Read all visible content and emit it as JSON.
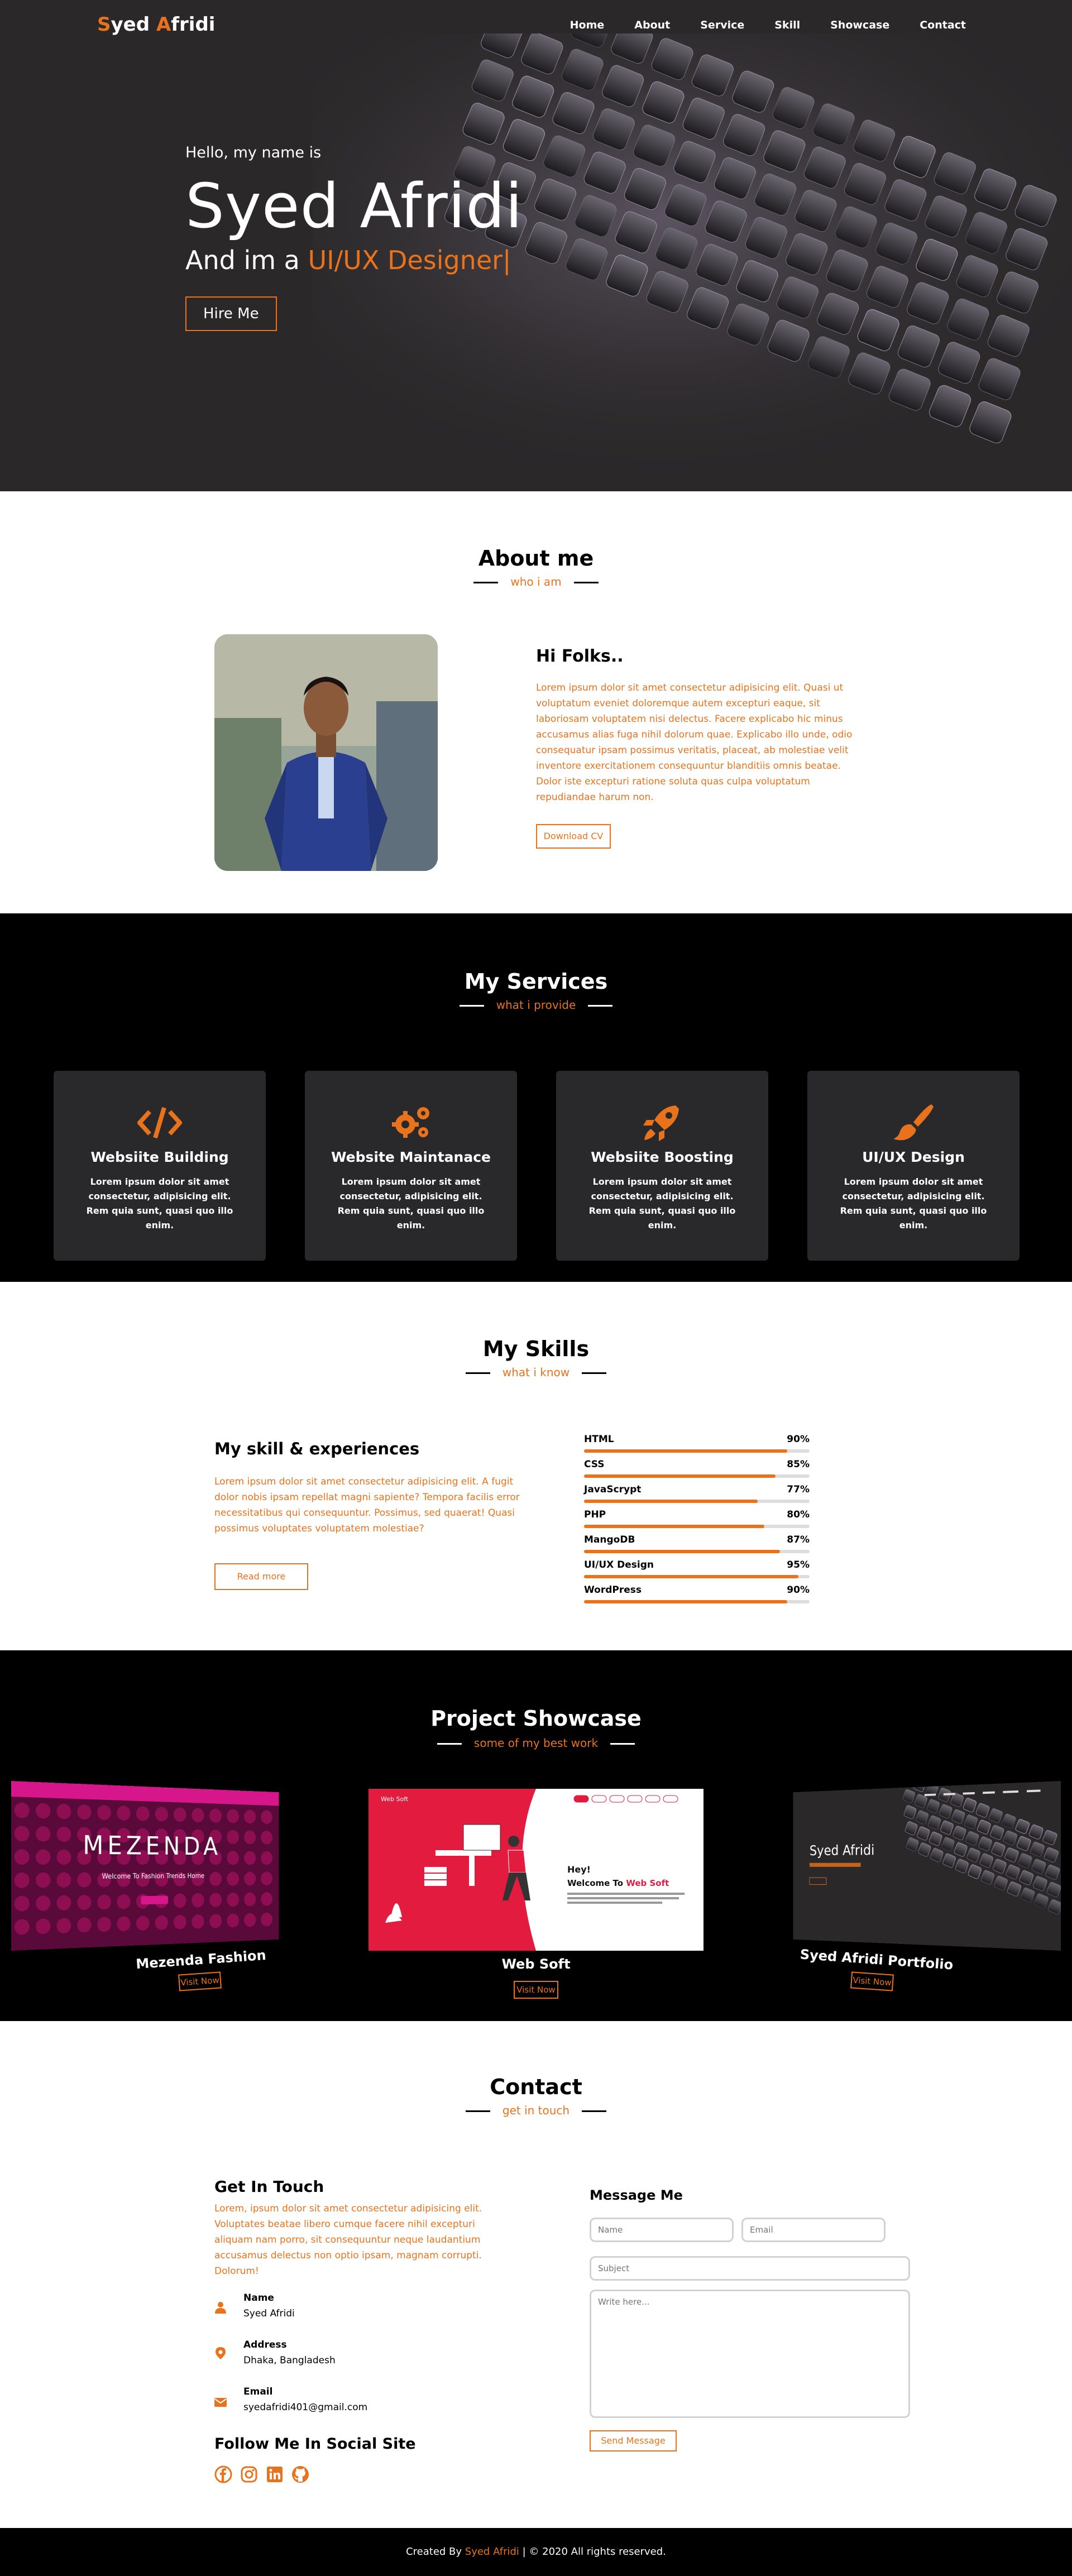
{
  "nav": {
    "logo_first_initial": "S",
    "logo_first_rest": "yed ",
    "logo_last_initial": "A",
    "logo_last_rest": "fridi",
    "items": [
      "Home",
      "About",
      "Service",
      "Skill",
      "Showcase",
      "Contact"
    ]
  },
  "hero": {
    "greeting": "Hello, my name is",
    "name": "Syed Afridi",
    "tagline_prefix": "And im a ",
    "tagline_role": "UI/UX Designer|",
    "hire_button": "Hire Me"
  },
  "about": {
    "title": "About me",
    "subtitle": "who i am",
    "heading": "Hi Folks..",
    "body": "Lorem ipsum dolor sit amet consectetur adipisicing elit. Quasi ut voluptatum eveniet doloremque autem excepturi eaque, sit laboriosam voluptatem nisi delectus. Facere explicabo hic minus accusamus alias fuga nihil dolorum quae. Explicabo illo unde, odio consequatur ipsam possimus veritatis, placeat, ab molestiae velit inventore exercitationem consequuntur blanditiis omnis beatae. Dolor iste excepturi ratione soluta quas culpa voluptatum repudiandae harum non.",
    "cv_button": "Download CV"
  },
  "services": {
    "title": "My Services",
    "subtitle": "what i provide",
    "cards": [
      {
        "icon": "code-icon",
        "title": "Websiite Building",
        "text": "Lorem ipsum dolor sit amet consectetur, adipisicing elit. Rem quia sunt, quasi quo illo enim."
      },
      {
        "icon": "gears-icon",
        "title": "Website Maintanace",
        "text": "Lorem ipsum dolor sit amet consectetur, adipisicing elit. Rem quia sunt, quasi quo illo enim."
      },
      {
        "icon": "rocket-icon",
        "title": "Websiite Boosting",
        "text": "Lorem ipsum dolor sit amet consectetur, adipisicing elit. Rem quia sunt, quasi quo illo enim."
      },
      {
        "icon": "paintbrush-icon",
        "title": "UI/UX Design",
        "text": "Lorem ipsum dolor sit amet consectetur, adipisicing elit. Rem quia sunt, quasi quo illo enim."
      }
    ]
  },
  "skills": {
    "title": "My Skills",
    "subtitle": "what i know",
    "heading": "My skill & experiences",
    "body": "Lorem ipsum dolor sit amet consectetur adipisicing elit. A fugit dolor nobis ipsam repellat magni sapiente? Tempora facilis error necessitatibus qui consequuntur. Possimus, sed quaerat! Quasi possimus voluptates voluptatem molestiae?",
    "read_more": "Read more",
    "items": [
      {
        "name": "HTML",
        "percent": "90%",
        "level": 90
      },
      {
        "name": "CSS",
        "percent": "85%",
        "level": 85
      },
      {
        "name": "JavaScrypt",
        "percent": "77%",
        "level": 77
      },
      {
        "name": "PHP",
        "percent": "80%",
        "level": 80
      },
      {
        "name": "MangoDB",
        "percent": "87%",
        "level": 87
      },
      {
        "name": "UI/UX Design",
        "percent": "95%",
        "level": 95
      },
      {
        "name": "WordPress",
        "percent": "90%",
        "level": 90
      }
    ]
  },
  "showcase": {
    "title": "Project Showcase",
    "subtitle": "some of my best work",
    "projects": [
      {
        "name": "Mezenda Fashion",
        "screen_title": "MEZENDA",
        "screen_text": "Welcome To Fashion Trends Home",
        "button": "Visit Now"
      },
      {
        "name": "Web Soft",
        "screen_logo": "Web Soft",
        "screen_greeting": "Hey!",
        "screen_welcome": "Welcome To ",
        "screen_brand": "Web Soft",
        "button": "Visit Now"
      },
      {
        "name": "Syed Afridi Portfolio",
        "screen_name": "Syed Afridi",
        "button": "Visit Now"
      }
    ]
  },
  "contact": {
    "title": "Contact",
    "subtitle": "get in touch",
    "heading": "Get In Touch",
    "body": "Lorem, ipsum dolor sit amet consectetur adipisicing elit. Voluptates beatae libero cumque facere nihil excepturi aliquam nam porro, sit consequuntur neque laudantium accusamus delectus non optio ipsam, magnam corrupti. Dolorum!",
    "info": [
      {
        "icon": "user-icon",
        "label": "Name",
        "value": "Syed Afridi"
      },
      {
        "icon": "location-icon",
        "label": "Address",
        "value": "Dhaka, Bangladesh"
      },
      {
        "icon": "envelope-icon",
        "label": "Email",
        "value": "syedafridi401@gmail.com"
      }
    ],
    "follow": "Follow Me In Social Site",
    "form_title": "Message Me",
    "name_placeholder": "Name",
    "email_placeholder": "Email",
    "subject_placeholder": "Subject",
    "message_placeholder": "Write here...",
    "send_button": "Send Message"
  },
  "footer": {
    "prefix": "Created By ",
    "author": "Syed Afridi",
    "suffix": " | © 2020 All rights reserved."
  },
  "colors": {
    "accent": "#e8731c",
    "dark": "#000000",
    "card": "#29292b"
  }
}
